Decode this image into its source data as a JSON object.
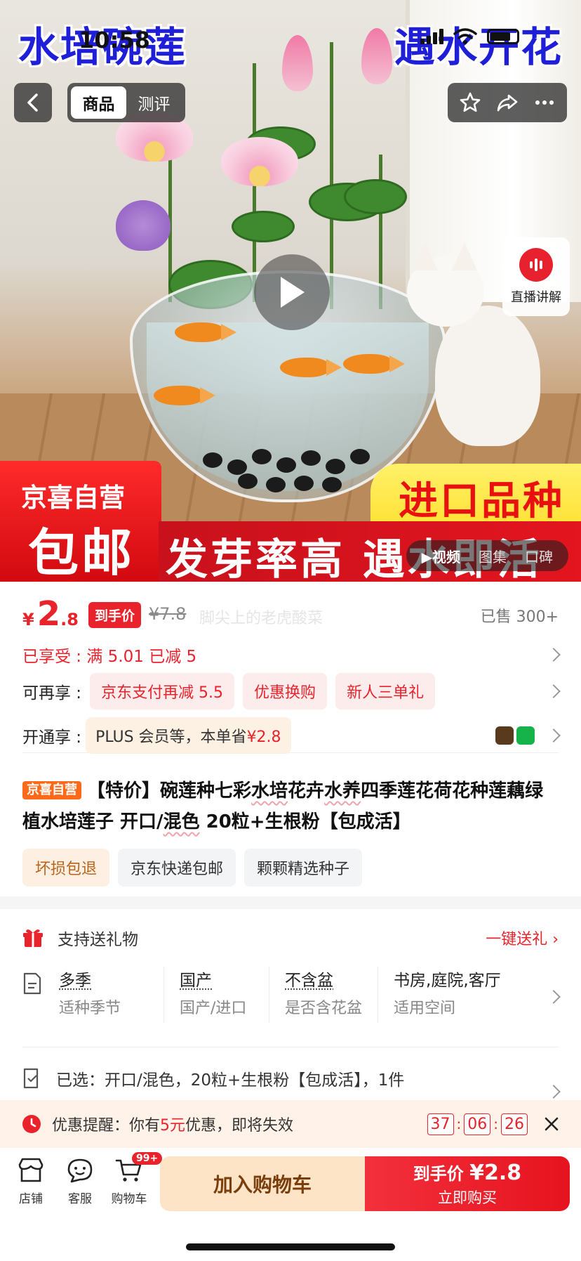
{
  "status_bar": {
    "time": "10:58"
  },
  "hero": {
    "title_left": "水培碗莲",
    "title_right": "遇水开花",
    "promo_left_line1": "京喜自营",
    "promo_left_line2": "包邮",
    "promo_right": "进口品种",
    "promo_bottom": "发芽率高  遇水即活",
    "tabs": [
      "商品",
      "测评"
    ],
    "active_tab": "商品",
    "live_label": "直播讲解",
    "media_tabs": [
      "▶视频",
      "图集",
      "口碑"
    ]
  },
  "price": {
    "currency": "¥",
    "integer": "2",
    "decimal": ".8",
    "tag": "到手价",
    "original": "¥7.8",
    "watermark": "脚尖上的老虎酸菜",
    "sold": "已售 300+"
  },
  "discounts": {
    "enjoyed": "已享受 : 满 5.01 已减 5",
    "more_label": "可再享 :",
    "more_pills": [
      "京东支付再减 5.5",
      "优惠换购",
      "新人三单礼"
    ],
    "plus_label": "开通享 :",
    "plus_text": "PLUS 会员等，本单省",
    "plus_amount": "¥2.8"
  },
  "product": {
    "badge": "京喜自营",
    "title_parts": [
      "【特价】碗莲种七彩",
      "水培",
      "花卉",
      "水养",
      "四季莲花荷花种莲藕绿植水培莲子 开口/",
      "混色",
      " 20粒+生根粉【包成活】"
    ],
    "service_tags": [
      "坏损包退",
      "京东快递包邮",
      "颗颗精选种子"
    ]
  },
  "gift": {
    "label": "支持送礼物",
    "action": "一键送礼 ›"
  },
  "specs": [
    {
      "value": "多季",
      "key": "适种季节"
    },
    {
      "value": "国产",
      "key": "国产/进口"
    },
    {
      "value": "不含盆",
      "key": "是否含花盆"
    },
    {
      "value": "书房,庭院,客厅",
      "key": "适用空间"
    }
  ],
  "selected": {
    "text": "已选：开口/混色，20粒+生根粉【包成活】，1件"
  },
  "reminder": {
    "prefix": "优惠提醒：你有",
    "amount": "5元",
    "suffix": "优惠，即将失效",
    "timer": [
      "37",
      "06",
      "26"
    ]
  },
  "bottom_bar": {
    "store": "店铺",
    "service": "客服",
    "cart": "购物车",
    "cart_badge": "99+",
    "add_to_cart": "加入购物车",
    "buy_line1_prefix": "到手价",
    "buy_price": "¥2.8",
    "buy_line2": "立即购买"
  },
  "colors": {
    "accent": "#e9232c",
    "cart_bg": "#fde4c6",
    "promo_red": "#d10a10"
  }
}
